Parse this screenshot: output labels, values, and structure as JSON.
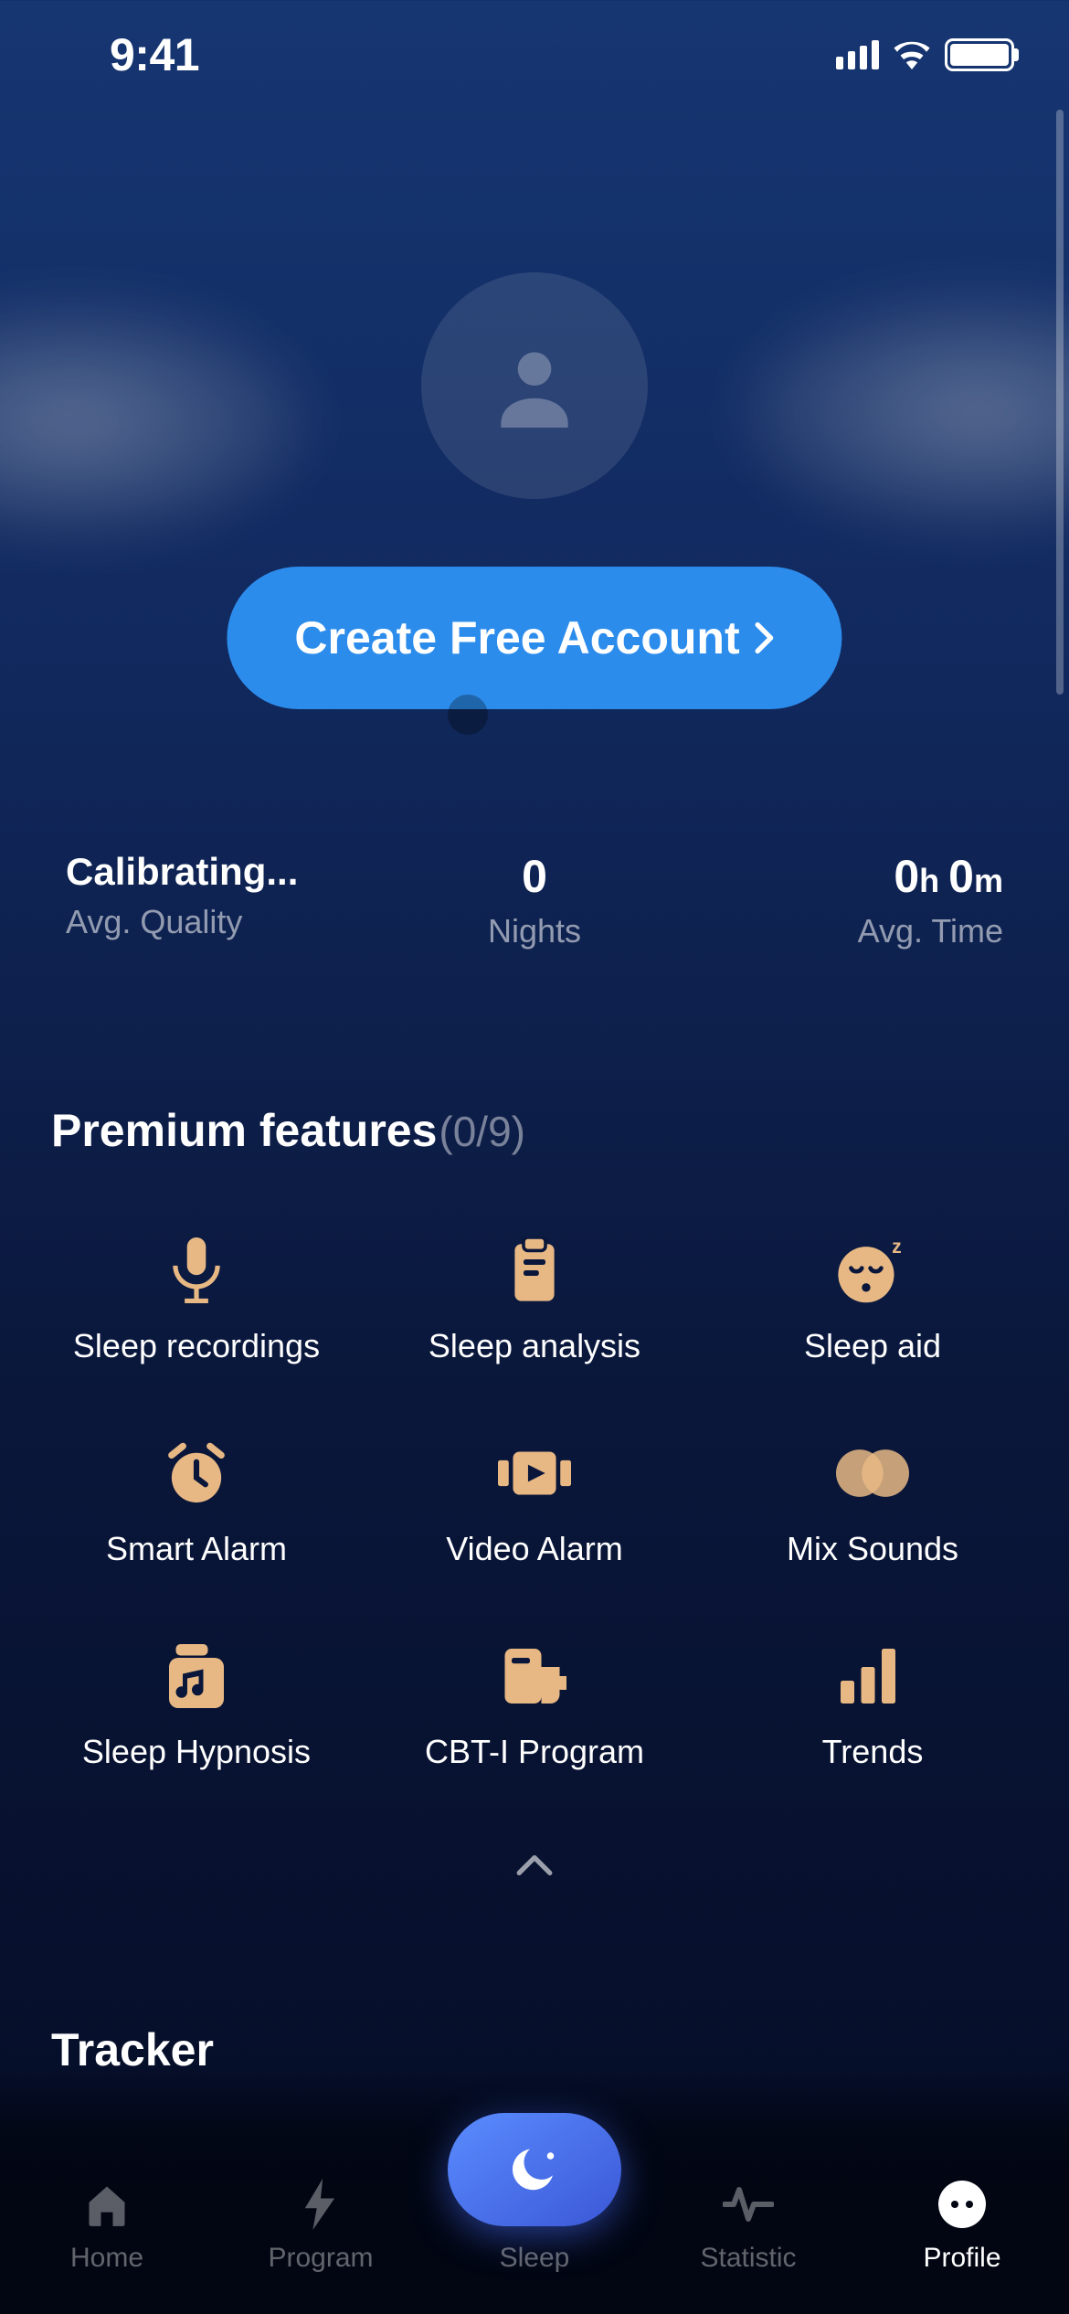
{
  "status_bar": {
    "time": "9:41"
  },
  "cta": {
    "label": "Create Free Account"
  },
  "stats": [
    {
      "value": "Calibrating...",
      "label": "Avg. Quality",
      "is_value_text": true
    },
    {
      "value": "0",
      "label": "Nights"
    },
    {
      "value_h": "0",
      "value_m": "0",
      "label": "Avg. Time",
      "is_time": true
    }
  ],
  "premium": {
    "title": "Premium features",
    "count": "(0/9)",
    "features": [
      {
        "label": "Sleep recordings",
        "icon": "mic"
      },
      {
        "label": "Sleep analysis",
        "icon": "clipboard"
      },
      {
        "label": "Sleep aid",
        "icon": "sleep-face"
      },
      {
        "label": "Smart Alarm",
        "icon": "alarm"
      },
      {
        "label": "Video Alarm",
        "icon": "video"
      },
      {
        "label": "Mix Sounds",
        "icon": "venn"
      },
      {
        "label": "Sleep Hypnosis",
        "icon": "music-box"
      },
      {
        "label": "CBT-I Program",
        "icon": "doc-cup"
      },
      {
        "label": "Trends",
        "icon": "bars"
      }
    ]
  },
  "tracker": {
    "title": "Tracker"
  },
  "tabs": [
    {
      "label": "Home",
      "icon": "home"
    },
    {
      "label": "Program",
      "icon": "bolt"
    },
    {
      "label": "Sleep",
      "icon": "moon",
      "center": true
    },
    {
      "label": "Statistic",
      "icon": "pulse"
    },
    {
      "label": "Profile",
      "icon": "face",
      "active": true
    }
  ]
}
